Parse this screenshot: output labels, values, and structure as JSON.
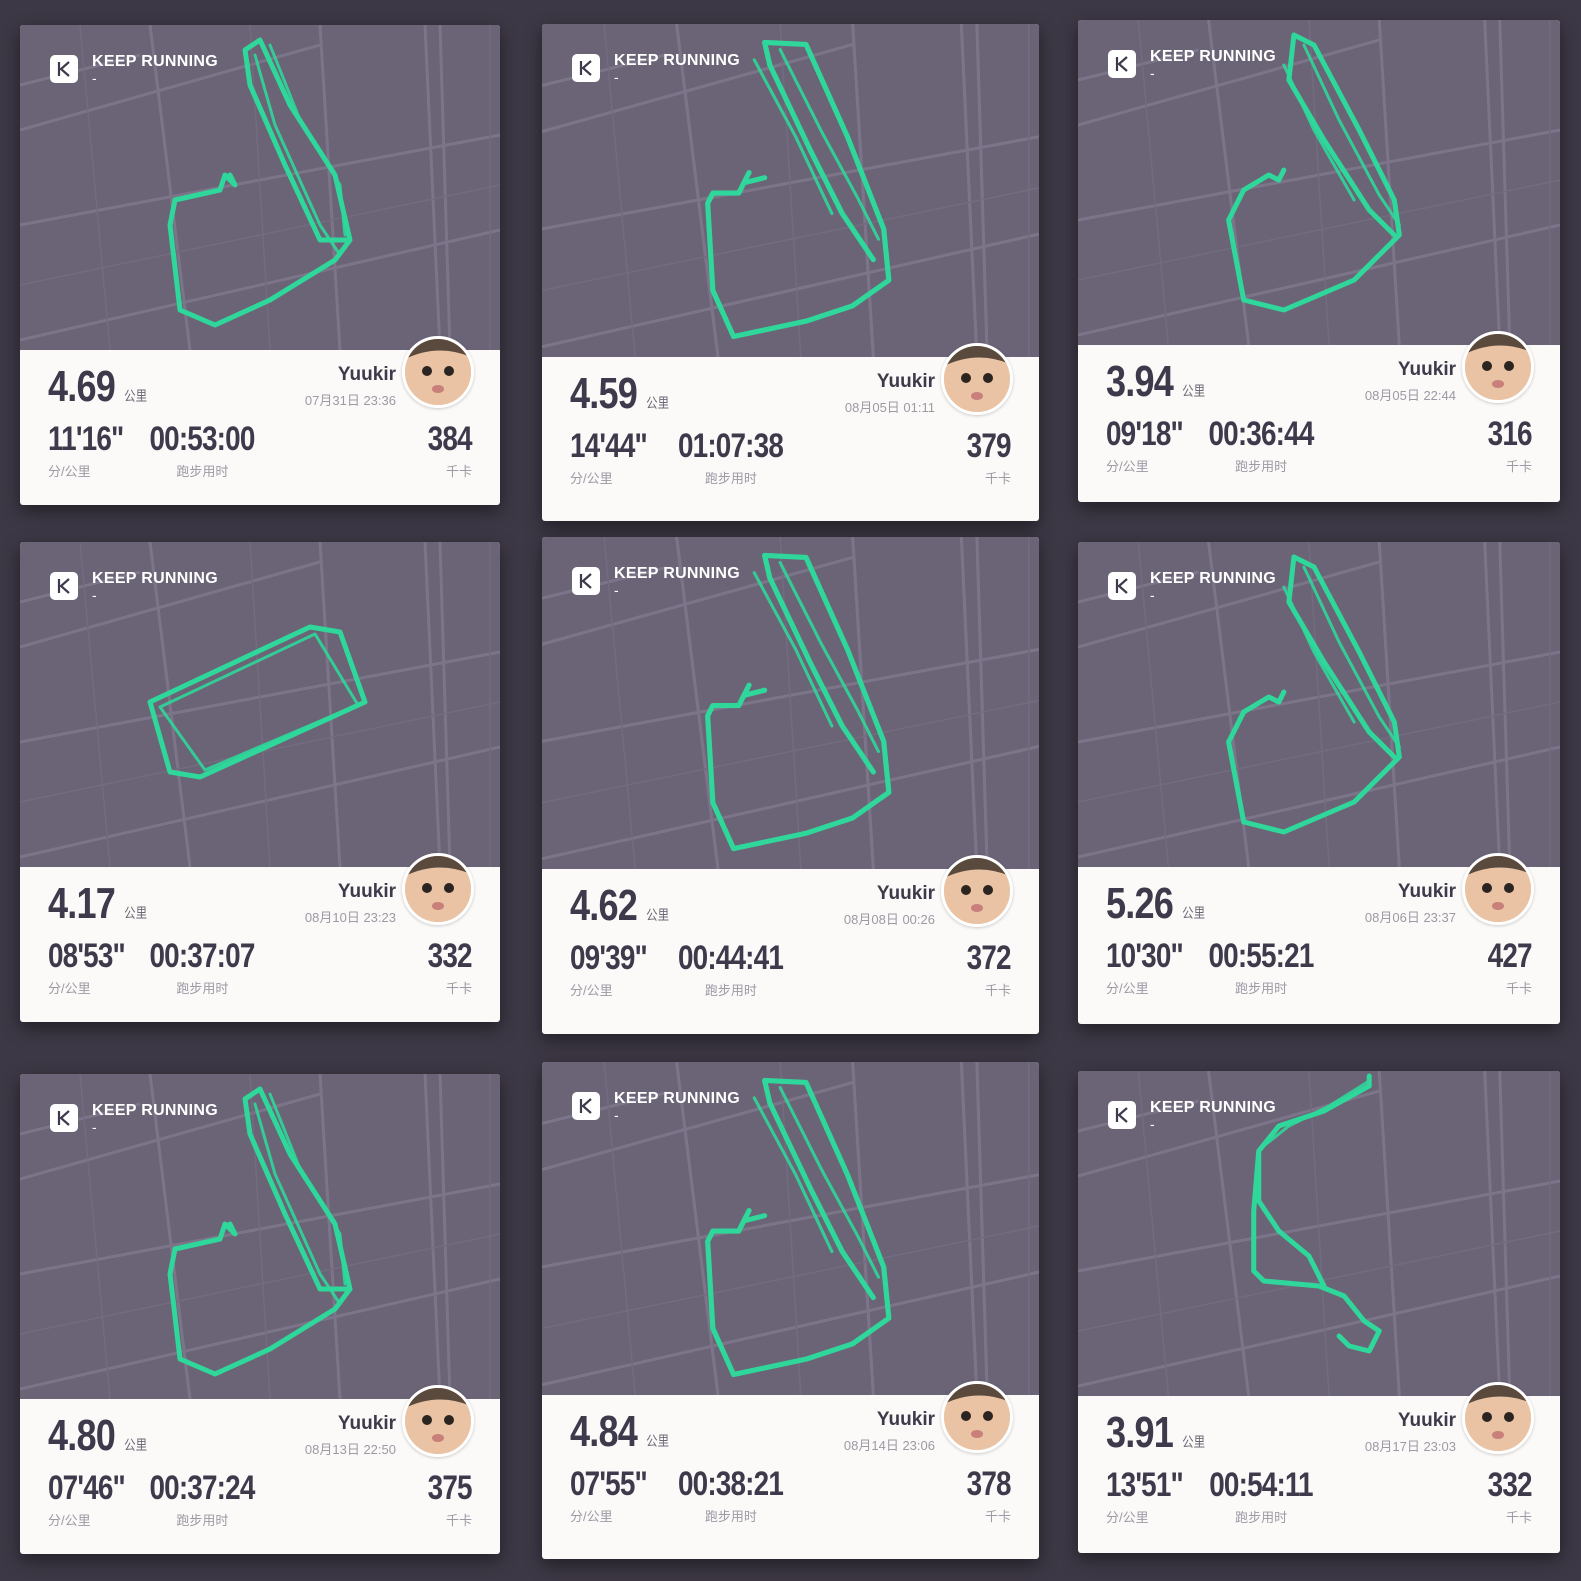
{
  "colors": {
    "background": "#3d3845",
    "map": "#6a6476",
    "route": "#2fd79a",
    "card": "#fbfaf8",
    "text": "#3f3a4b"
  },
  "cards": [
    {
      "brand": "KEEP RUNNING",
      "brand_sub": "-",
      "distance": "4.69",
      "distance_unit": "公里",
      "user": "Yuukir",
      "date": "07月31日 23:36",
      "pace": "11'16\"",
      "pace_label": "分/公里",
      "duration": "00:53:00",
      "duration_label": "跑步用时",
      "calories": "384",
      "calories_label": "千卡"
    },
    {
      "brand": "KEEP RUNNING",
      "brand_sub": "-",
      "distance": "4.59",
      "distance_unit": "公里",
      "user": "Yuukir",
      "date": "08月05日 01:11",
      "pace": "14'44\"",
      "pace_label": "分/公里",
      "duration": "01:07:38",
      "duration_label": "跑步用时",
      "calories": "379",
      "calories_label": "千卡"
    },
    {
      "brand": "KEEP RUNNING",
      "brand_sub": "-",
      "distance": "3.94",
      "distance_unit": "公里",
      "user": "Yuukir",
      "date": "08月05日 22:44",
      "pace": "09'18\"",
      "pace_label": "分/公里",
      "duration": "00:36:44",
      "duration_label": "跑步用时",
      "calories": "316",
      "calories_label": "千卡"
    },
    {
      "brand": "KEEP RUNNING",
      "brand_sub": "-",
      "distance": "4.17",
      "distance_unit": "公里",
      "user": "Yuukir",
      "date": "08月10日 23:23",
      "pace": "08'53\"",
      "pace_label": "分/公里",
      "duration": "00:37:07",
      "duration_label": "跑步用时",
      "calories": "332",
      "calories_label": "千卡"
    },
    {
      "brand": "KEEP RUNNING",
      "brand_sub": "-",
      "distance": "4.62",
      "distance_unit": "公里",
      "user": "Yuukir",
      "date": "08月08日 00:26",
      "pace": "09'39\"",
      "pace_label": "分/公里",
      "duration": "00:44:41",
      "duration_label": "跑步用时",
      "calories": "372",
      "calories_label": "千卡"
    },
    {
      "brand": "KEEP RUNNING",
      "brand_sub": "-",
      "distance": "5.26",
      "distance_unit": "公里",
      "user": "Yuukir",
      "date": "08月06日 23:37",
      "pace": "10'30\"",
      "pace_label": "分/公里",
      "duration": "00:55:21",
      "duration_label": "跑步用时",
      "calories": "427",
      "calories_label": "千卡"
    },
    {
      "brand": "KEEP RUNNING",
      "brand_sub": "-",
      "distance": "4.80",
      "distance_unit": "公里",
      "user": "Yuukir",
      "date": "08月13日 22:50",
      "pace": "07'46\"",
      "pace_label": "分/公里",
      "duration": "00:37:24",
      "duration_label": "跑步用时",
      "calories": "375",
      "calories_label": "千卡"
    },
    {
      "brand": "KEEP RUNNING",
      "brand_sub": "-",
      "distance": "4.84",
      "distance_unit": "公里",
      "user": "Yuukir",
      "date": "08月14日 23:06",
      "pace": "07'55\"",
      "pace_label": "分/公里",
      "duration": "00:38:21",
      "duration_label": "跑步用时",
      "calories": "378",
      "calories_label": "千卡"
    },
    {
      "brand": "KEEP RUNNING",
      "brand_sub": "-",
      "distance": "3.91",
      "distance_unit": "公里",
      "user": "Yuukir",
      "date": "08月17日 23:03",
      "pace": "13'51\"",
      "pace_label": "分/公里",
      "duration": "00:54:11",
      "duration_label": "跑步用时",
      "calories": "332",
      "calories_label": "千卡"
    }
  ]
}
